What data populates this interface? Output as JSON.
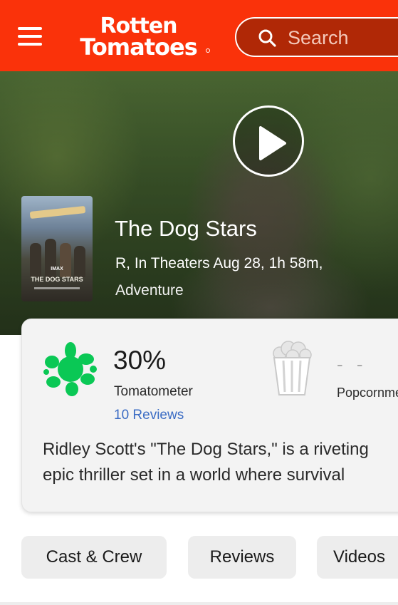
{
  "header": {
    "logo_line1": "Rotten",
    "logo_line2": "Tomatoes",
    "search_placeholder": "Search"
  },
  "movie": {
    "title": "The Dog Stars",
    "meta": "R, In Theaters Aug 28, 1h 58m,",
    "genre": "Adventure",
    "poster_imax": "IMAX",
    "poster_title": "THE DOG STARS"
  },
  "scores": {
    "tomatometer_value": "30%",
    "tomatometer_label": "Tomatometer",
    "tomatometer_reviews": "10 Reviews",
    "popcornmeter_value": "- -",
    "popcornmeter_label": "Popcornmeter"
  },
  "synopsis": {
    "line1": "Ridley Scott's \"The Dog Stars,\" is a riveting",
    "line2": "epic thriller set in a world where survival"
  },
  "tabs": [
    {
      "label": "Cast & Crew"
    },
    {
      "label": "Reviews"
    },
    {
      "label": "Videos"
    }
  ],
  "colors": {
    "brand_red": "#fa320a",
    "splat_green": "#0ac855",
    "link_blue": "#3b6cc4"
  },
  "icons": {
    "menu": "menu-icon",
    "search": "search-icon",
    "play": "play-icon",
    "tomatometer": "green-splat-icon",
    "popcornmeter": "popcorn-bucket-icon"
  }
}
